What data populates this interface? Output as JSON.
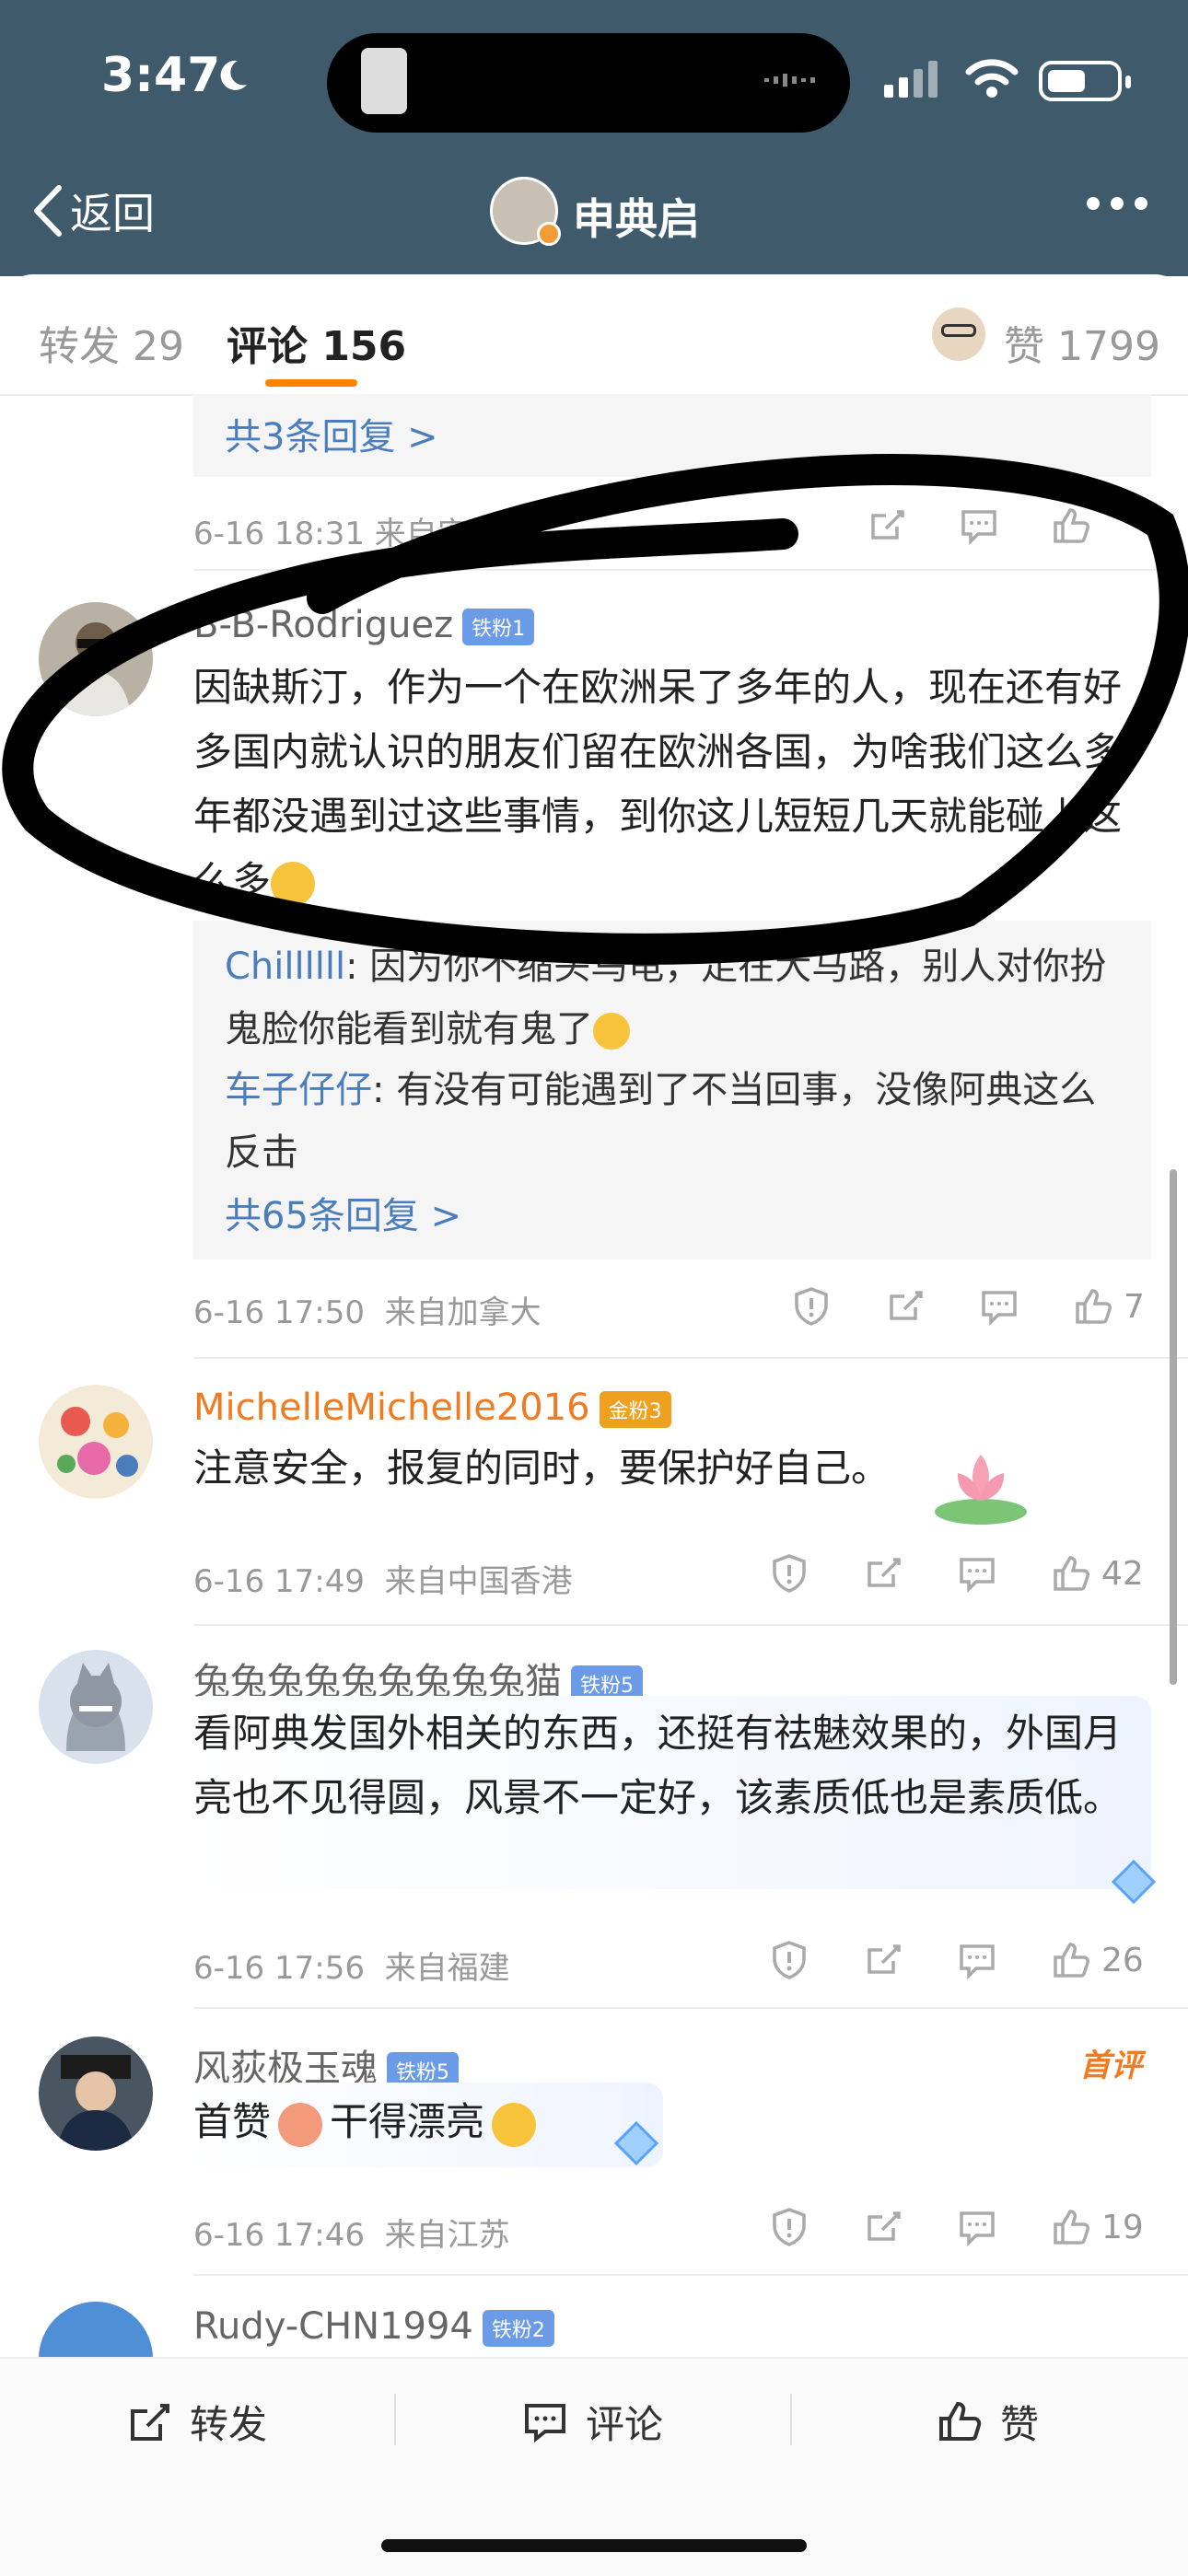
{
  "status": {
    "time": "3:47"
  },
  "header": {
    "back_label": "返回",
    "title": "申典启"
  },
  "tabs": {
    "repost": "转发 29",
    "comments": "评论 156",
    "likes": "赞 1799"
  },
  "top_partial": {
    "reply_link": "共3条回复 >",
    "meta": "6-16 18:31 来自安徽"
  },
  "comments": [
    {
      "name": "B-B-Rodriguez",
      "fan_badge": "铁粉1",
      "text": "因缺斯汀，作为一个在欧洲呆了多年的人，现在还有好多国内就认识的朋友们留在欧洲各国，为啥我们这么多年都没遇到过这些事情，到你这儿短短几天就能碰上这么多",
      "replies": [
        {
          "user": "Chillllll",
          "text": ": 因为你不缩头乌龟，走在大马路，别人对你扮鬼脸你能看到就有鬼了"
        },
        {
          "user": "车子仔仔",
          "text": ": 有没有可能遇到了不当回事，没像阿典这么反击"
        }
      ],
      "reply_link": "共65条回复 >",
      "time": "6-16 17:50",
      "location": "来自加拿大",
      "likes": "7"
    },
    {
      "name": "MichelleMichelle2016",
      "fan_badge": "金粉3",
      "text": "注意安全，报复的同时，要保护好自己。",
      "time": "6-16 17:49",
      "location": "来自中国香港",
      "likes": "42"
    },
    {
      "name": "兔兔兔兔兔兔兔兔兔猫",
      "fan_badge": "铁粉5",
      "text": "看阿典发国外相关的东西，还挺有祛魅效果的，外国月亮也不见得圆，风景不一定好，该素质低也是素质低。",
      "time": "6-16 17:56",
      "location": "来自福建",
      "likes": "26"
    },
    {
      "name": "风荻极玉魂",
      "fan_badge": "铁粉5",
      "first_tag": "首评",
      "text_a": "首赞",
      "text_b": "干得漂亮",
      "time": "6-16 17:46",
      "location": "来自江苏",
      "likes": "19"
    },
    {
      "name": "Rudy-CHN1994",
      "fan_badge": "铁粉2"
    }
  ],
  "bottom_bar": {
    "repost": "转发",
    "comment": "评论",
    "like": "赞"
  },
  "colors": {
    "header_bg": "#3e5a6b",
    "accent": "#ff8200",
    "link": "#4a7dbd"
  }
}
